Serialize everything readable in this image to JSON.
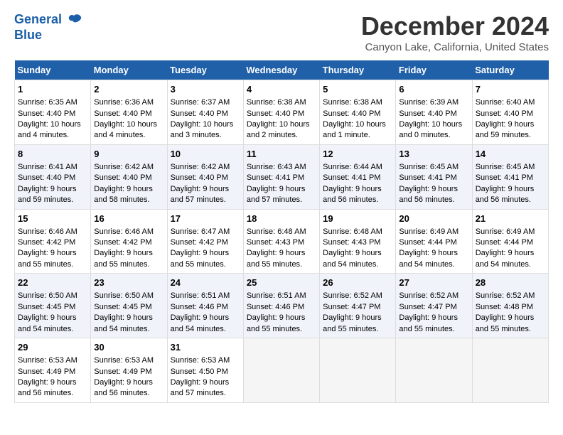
{
  "logo": {
    "line1": "General",
    "line2": "Blue"
  },
  "title": "December 2024",
  "subtitle": "Canyon Lake, California, United States",
  "days_of_week": [
    "Sunday",
    "Monday",
    "Tuesday",
    "Wednesday",
    "Thursday",
    "Friday",
    "Saturday"
  ],
  "weeks": [
    [
      {
        "day": 1,
        "sunrise": "6:35 AM",
        "sunset": "4:40 PM",
        "daylight": "10 hours and 4 minutes."
      },
      {
        "day": 2,
        "sunrise": "6:36 AM",
        "sunset": "4:40 PM",
        "daylight": "10 hours and 4 minutes."
      },
      {
        "day": 3,
        "sunrise": "6:37 AM",
        "sunset": "4:40 PM",
        "daylight": "10 hours and 3 minutes."
      },
      {
        "day": 4,
        "sunrise": "6:38 AM",
        "sunset": "4:40 PM",
        "daylight": "10 hours and 2 minutes."
      },
      {
        "day": 5,
        "sunrise": "6:38 AM",
        "sunset": "4:40 PM",
        "daylight": "10 hours and 1 minute."
      },
      {
        "day": 6,
        "sunrise": "6:39 AM",
        "sunset": "4:40 PM",
        "daylight": "10 hours and 0 minutes."
      },
      {
        "day": 7,
        "sunrise": "6:40 AM",
        "sunset": "4:40 PM",
        "daylight": "9 hours and 59 minutes."
      }
    ],
    [
      {
        "day": 8,
        "sunrise": "6:41 AM",
        "sunset": "4:40 PM",
        "daylight": "9 hours and 59 minutes."
      },
      {
        "day": 9,
        "sunrise": "6:42 AM",
        "sunset": "4:40 PM",
        "daylight": "9 hours and 58 minutes."
      },
      {
        "day": 10,
        "sunrise": "6:42 AM",
        "sunset": "4:40 PM",
        "daylight": "9 hours and 57 minutes."
      },
      {
        "day": 11,
        "sunrise": "6:43 AM",
        "sunset": "4:41 PM",
        "daylight": "9 hours and 57 minutes."
      },
      {
        "day": 12,
        "sunrise": "6:44 AM",
        "sunset": "4:41 PM",
        "daylight": "9 hours and 56 minutes."
      },
      {
        "day": 13,
        "sunrise": "6:45 AM",
        "sunset": "4:41 PM",
        "daylight": "9 hours and 56 minutes."
      },
      {
        "day": 14,
        "sunrise": "6:45 AM",
        "sunset": "4:41 PM",
        "daylight": "9 hours and 56 minutes."
      }
    ],
    [
      {
        "day": 15,
        "sunrise": "6:46 AM",
        "sunset": "4:42 PM",
        "daylight": "9 hours and 55 minutes."
      },
      {
        "day": 16,
        "sunrise": "6:46 AM",
        "sunset": "4:42 PM",
        "daylight": "9 hours and 55 minutes."
      },
      {
        "day": 17,
        "sunrise": "6:47 AM",
        "sunset": "4:42 PM",
        "daylight": "9 hours and 55 minutes."
      },
      {
        "day": 18,
        "sunrise": "6:48 AM",
        "sunset": "4:43 PM",
        "daylight": "9 hours and 55 minutes."
      },
      {
        "day": 19,
        "sunrise": "6:48 AM",
        "sunset": "4:43 PM",
        "daylight": "9 hours and 54 minutes."
      },
      {
        "day": 20,
        "sunrise": "6:49 AM",
        "sunset": "4:44 PM",
        "daylight": "9 hours and 54 minutes."
      },
      {
        "day": 21,
        "sunrise": "6:49 AM",
        "sunset": "4:44 PM",
        "daylight": "9 hours and 54 minutes."
      }
    ],
    [
      {
        "day": 22,
        "sunrise": "6:50 AM",
        "sunset": "4:45 PM",
        "daylight": "9 hours and 54 minutes."
      },
      {
        "day": 23,
        "sunrise": "6:50 AM",
        "sunset": "4:45 PM",
        "daylight": "9 hours and 54 minutes."
      },
      {
        "day": 24,
        "sunrise": "6:51 AM",
        "sunset": "4:46 PM",
        "daylight": "9 hours and 54 minutes."
      },
      {
        "day": 25,
        "sunrise": "6:51 AM",
        "sunset": "4:46 PM",
        "daylight": "9 hours and 55 minutes."
      },
      {
        "day": 26,
        "sunrise": "6:52 AM",
        "sunset": "4:47 PM",
        "daylight": "9 hours and 55 minutes."
      },
      {
        "day": 27,
        "sunrise": "6:52 AM",
        "sunset": "4:47 PM",
        "daylight": "9 hours and 55 minutes."
      },
      {
        "day": 28,
        "sunrise": "6:52 AM",
        "sunset": "4:48 PM",
        "daylight": "9 hours and 55 minutes."
      }
    ],
    [
      {
        "day": 29,
        "sunrise": "6:53 AM",
        "sunset": "4:49 PM",
        "daylight": "9 hours and 56 minutes."
      },
      {
        "day": 30,
        "sunrise": "6:53 AM",
        "sunset": "4:49 PM",
        "daylight": "9 hours and 56 minutes."
      },
      {
        "day": 31,
        "sunrise": "6:53 AM",
        "sunset": "4:50 PM",
        "daylight": "9 hours and 57 minutes."
      },
      null,
      null,
      null,
      null
    ]
  ]
}
